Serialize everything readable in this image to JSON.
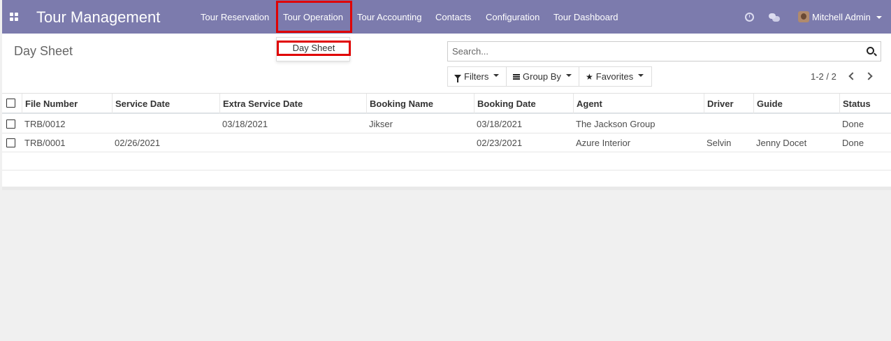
{
  "app": {
    "title": "Tour Management"
  },
  "menu": {
    "items": [
      {
        "label": "Tour Reservation"
      },
      {
        "label": "Tour Operation"
      },
      {
        "label": "Tour Accounting"
      },
      {
        "label": "Contacts"
      },
      {
        "label": "Configuration"
      },
      {
        "label": "Tour Dashboard"
      }
    ],
    "dropdown": {
      "items": [
        {
          "label": "Day Sheet"
        }
      ]
    }
  },
  "user": {
    "name": "Mitchell Admin"
  },
  "page": {
    "breadcrumb": "Day Sheet"
  },
  "search": {
    "placeholder": "Search..."
  },
  "toolbar": {
    "filters_label": "Filters",
    "group_by_label": "Group By",
    "favorites_label": "Favorites"
  },
  "pager": {
    "text": "1-2 / 2"
  },
  "table": {
    "headers": [
      "File Number",
      "Service Date",
      "Extra Service Date",
      "Booking Name",
      "Booking Date",
      "Agent",
      "Driver",
      "Guide",
      "Status"
    ],
    "rows": [
      [
        "TRB/0012",
        "",
        "03/18/2021",
        "Jikser",
        "03/18/2021",
        "The Jackson Group",
        "",
        "",
        "Done"
      ],
      [
        "TRB/0001",
        "02/26/2021",
        "",
        "",
        "02/23/2021",
        "Azure Interior",
        "Selvin",
        "Jenny Docet",
        "Done"
      ]
    ]
  },
  "colors": {
    "navbar": "#7c7bad",
    "highlight": "#e00000"
  }
}
